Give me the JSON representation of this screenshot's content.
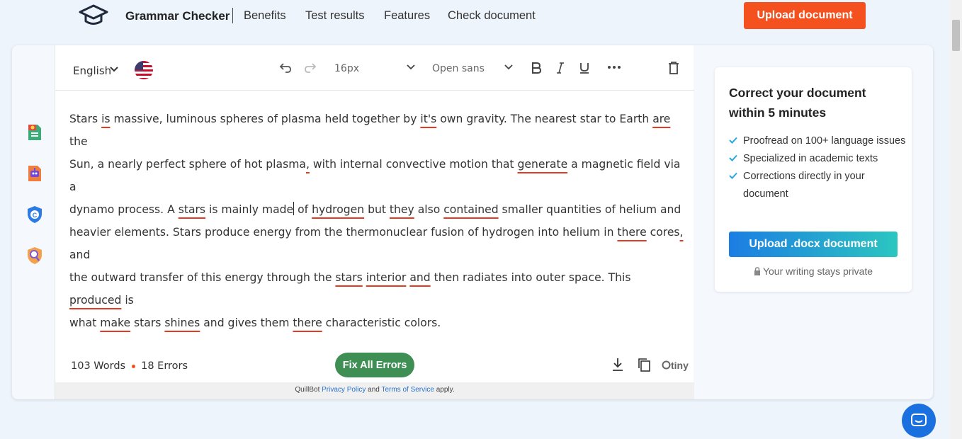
{
  "nav": {
    "brand": "Grammar Checker",
    "links": [
      "Benefits",
      "Test results",
      "Features",
      "Check document"
    ],
    "upload_label": "Upload document"
  },
  "editor": {
    "language": "English",
    "font_size": "16px",
    "font_family": "Open sans",
    "text": {
      "l1a": "Stars ",
      "l1e1": "is",
      "l1b": " massive, luminous spheres of plasma held together by ",
      "l1e2": "it's",
      "l1c": " own gravity. The nearest star to Earth ",
      "l1e3": "are",
      "l1d": " the",
      "l2a": "Sun, a nearly perfect sphere of hot plasma",
      "l2e1": ",",
      "l2b": " with internal convective motion that ",
      "l2e2": "generate",
      "l2c": " a magnetic field via a",
      "l3a": "dynamo process. A ",
      "l3e1": "stars",
      "l3b": " is mainly made",
      "l3c": " of ",
      "l3e2": "hydrogen",
      "l3d": " but ",
      "l3e3": "they",
      "l3e": " also ",
      "l3e4": "contained",
      "l3f": " smaller quantities of helium and",
      "l4a": "heavier elements. Stars produce energy from the thermonuclear fusion of hydrogen into helium in ",
      "l4e1": "there",
      "l4b": " cores",
      "l4e2": ",",
      "l4c": " and",
      "l5a": "the outward transfer of this energy through the ",
      "l5e1": "stars",
      "l5b": " ",
      "l5e2": "interior",
      "l5c": " ",
      "l5e3": "and",
      "l5d": " then radiates into outer space. This ",
      "l5e4": "produced",
      "l5e": " is",
      "l6a": "what ",
      "l6e1": "make",
      "l6b": " stars ",
      "l6e2": "shines",
      "l6c": " and gives them ",
      "l6e3": "there",
      "l6d": " characteristic colors."
    },
    "words": "103 Words",
    "errors": "18 Errors",
    "fix_label": "Fix All Errors",
    "tiny_label": "tiny",
    "legal": {
      "prefix": "QuillBot ",
      "privacy": "Privacy Policy",
      "and": " and ",
      "terms": "Terms of Service",
      "suffix": " apply."
    }
  },
  "promo": {
    "title": "Correct your document within 5 minutes",
    "items": [
      "Proofread on 100+ language issues",
      "Specialized in academic texts",
      "Corrections directly in your document"
    ],
    "button": "Upload .docx document",
    "private": "Your writing stays private"
  },
  "colors": {
    "accent": "#f4511e",
    "error_underline": "#e53a1f",
    "fix_button": "#3f8f55",
    "chat": "#1b70e0"
  },
  "icons": [
    "graduation-cap-logo",
    "undo-icon",
    "redo-icon",
    "bold-icon",
    "italic-icon",
    "underline-icon",
    "more-icon",
    "trash-icon",
    "download-icon",
    "copy-icon",
    "chat-icon"
  ]
}
